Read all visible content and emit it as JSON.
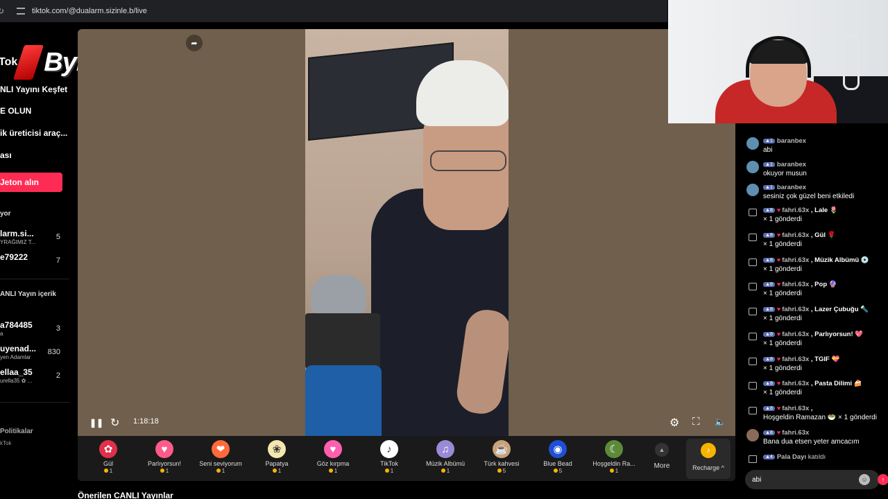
{
  "browser": {
    "url": "tiktok.com/@dualarm.sizinle.b/live"
  },
  "brand": {
    "tiktok_fragment": "Tok",
    "watermark": "ByNoGame"
  },
  "sidebar": {
    "items": [
      {
        "label": "NLI Yayını Keşfet"
      },
      {
        "label": "E OLUN"
      },
      {
        "label": "ik üreticisi araç..."
      },
      {
        "label": "ası"
      }
    ],
    "coins_button": "Jeton alın",
    "following_label": "yor",
    "following": [
      {
        "name": "larm.si...",
        "sub": "YRAĞIMIZ T...",
        "count": "5"
      },
      {
        "name": "e79222",
        "sub": "",
        "count": "7"
      }
    ],
    "recommended_label": "ANLI Yayın içerik",
    "recommended": [
      {
        "name": "a784485",
        "sub": "a",
        "count": "3"
      },
      {
        "name": "uyenad...",
        "sub": "yen Adamlar",
        "count": "830"
      },
      {
        "name": "ellaa_35",
        "sub": "urella35 ✿ ...",
        "count": "2"
      }
    ],
    "footer_policies": "Politikalar",
    "footer_tiktok": "kTok"
  },
  "player": {
    "time": "1:18:18"
  },
  "gifts": [
    {
      "name": "Gül",
      "price": "1",
      "icon": "rose",
      "color": "#e0304a",
      "glyph": "✿"
    },
    {
      "name": "Parlıyorsun!",
      "price": "1",
      "icon": "heart-badge",
      "color": "#ff5a8a",
      "glyph": "♥"
    },
    {
      "name": "Seni seviyorum",
      "price": "1",
      "icon": "love-heart",
      "color": "#ff6a3c",
      "glyph": "❤"
    },
    {
      "name": "Papatya",
      "price": "1",
      "icon": "daisy",
      "color": "#f5e6b0",
      "glyph": "❀"
    },
    {
      "name": "Göz kırpma",
      "price": "1",
      "icon": "wink-heart",
      "color": "#ff5fae",
      "glyph": "♥"
    },
    {
      "name": "TikTok",
      "price": "1",
      "icon": "tiktok",
      "color": "#ffffff",
      "glyph": "♪"
    },
    {
      "name": "Müzik Albümü",
      "price": "1",
      "icon": "music-album",
      "color": "#9a8ad6",
      "glyph": "♫"
    },
    {
      "name": "Türk kahvesi",
      "price": "5",
      "icon": "turkish-coffee",
      "color": "#c9a27a",
      "glyph": "☕"
    },
    {
      "name": "Blue Bead",
      "price": "5",
      "icon": "evil-eye",
      "color": "#1f4fd6",
      "glyph": "◉"
    },
    {
      "name": "Hoşgeldin Ra...",
      "price": "1",
      "icon": "ramazan",
      "color": "#5c8a3a",
      "glyph": "☾"
    }
  ],
  "gift_bar": {
    "more_label": "More",
    "recharge_label": "Recharge ^"
  },
  "suggested_title": "Önerilen CANLI Yayınlar",
  "chat": {
    "messages": [
      {
        "type": "comment",
        "level": "1",
        "user": "baranbex",
        "text": "abi",
        "avatar_color": "#5f8fb0"
      },
      {
        "type": "comment",
        "level": "1",
        "user": "baranbex",
        "text": "okuyor musun",
        "avatar_color": "#5f8fb0"
      },
      {
        "type": "comment",
        "level": "1",
        "user": "baranbex",
        "text": "sesiniz çok güzel beni etkiledi",
        "avatar_color": "#5f8fb0"
      },
      {
        "type": "gift",
        "level": "8",
        "user": "fahri.63x",
        "gift": ", Lale 🌷",
        "text": "× 1 gönderdi"
      },
      {
        "type": "gift",
        "level": "8",
        "user": "fahri.63x",
        "gift": ", Gül 🌹",
        "text": "× 1 gönderdi"
      },
      {
        "type": "gift",
        "level": "8",
        "user": "fahri.63x",
        "gift": ", Müzik Albümü 💿",
        "text": "× 1 gönderdi"
      },
      {
        "type": "gift",
        "level": "8",
        "user": "fahri.63x",
        "gift": ", Pop 🔮",
        "text": "× 1 gönderdi"
      },
      {
        "type": "gift",
        "level": "8",
        "user": "fahri.63x",
        "gift": ", Lazer Çubuğu 🔦",
        "text": "× 1 gönderdi"
      },
      {
        "type": "gift",
        "level": "8",
        "user": "fahri.63x",
        "gift": ", Parlıyorsun! 💖",
        "text": "× 1 gönderdi"
      },
      {
        "type": "gift",
        "level": "8",
        "user": "fahri.63x",
        "gift": ", TGIF 💝",
        "text": "× 1 gönderdi"
      },
      {
        "type": "gift",
        "level": "8",
        "user": "fahri.63x",
        "gift": ", Pasta Dilimi 🍰",
        "text": "× 1 gönderdi"
      },
      {
        "type": "gift",
        "level": "8",
        "user": "fahri.63x",
        "gift": ",",
        "text": "Hoşgeldin Ramazan 🥗 × 1 gönderdi"
      },
      {
        "type": "comment",
        "level": "8",
        "user": "fahri.63x",
        "text": "Bana dua etsen yeter amcacım",
        "avatar_color": "#8a6a5a"
      },
      {
        "type": "join",
        "level": "4",
        "user": "Pala Dayı",
        "text": "katıldı"
      }
    ],
    "input_value": "abi"
  }
}
